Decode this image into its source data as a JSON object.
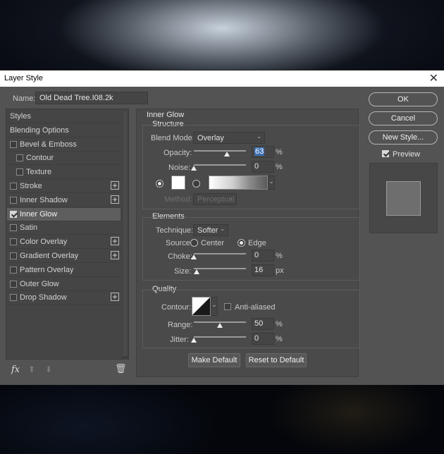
{
  "window": {
    "title": "Layer Style",
    "close_glyph": "✕"
  },
  "name_field": {
    "label": "Name:",
    "value": "Old Dead Tree.I08.2k"
  },
  "sidebar": {
    "items": [
      {
        "label": "Styles",
        "has_checkbox": false,
        "checked": false,
        "has_plus": false
      },
      {
        "label": "Blending Options",
        "has_checkbox": false,
        "checked": false,
        "has_plus": false
      },
      {
        "label": "Bevel & Emboss",
        "has_checkbox": true,
        "checked": false,
        "has_plus": false
      },
      {
        "label": "Contour",
        "has_checkbox": true,
        "checked": false,
        "has_plus": false,
        "indent": true
      },
      {
        "label": "Texture",
        "has_checkbox": true,
        "checked": false,
        "has_plus": false,
        "indent": true
      },
      {
        "label": "Stroke",
        "has_checkbox": true,
        "checked": false,
        "has_plus": true
      },
      {
        "label": "Inner Shadow",
        "has_checkbox": true,
        "checked": false,
        "has_plus": true
      },
      {
        "label": "Inner Glow",
        "has_checkbox": true,
        "checked": true,
        "has_plus": false,
        "selected": true
      },
      {
        "label": "Satin",
        "has_checkbox": true,
        "checked": false,
        "has_plus": false
      },
      {
        "label": "Color Overlay",
        "has_checkbox": true,
        "checked": false,
        "has_plus": true
      },
      {
        "label": "Gradient Overlay",
        "has_checkbox": true,
        "checked": false,
        "has_plus": true
      },
      {
        "label": "Pattern Overlay",
        "has_checkbox": true,
        "checked": false,
        "has_plus": false
      },
      {
        "label": "Outer Glow",
        "has_checkbox": true,
        "checked": false,
        "has_plus": false
      },
      {
        "label": "Drop Shadow",
        "has_checkbox": true,
        "checked": false,
        "has_plus": true
      }
    ],
    "footer": {
      "fx": "fx",
      "up_glyph": "⬆",
      "down_glyph": "⬇",
      "trash_glyph": "🗑"
    }
  },
  "inner_glow": {
    "title": "Inner Glow",
    "structure": {
      "title": "Structure",
      "blend_mode": {
        "label": "Blend Mode:",
        "value": "Overlay"
      },
      "opacity": {
        "label": "Opacity:",
        "value": "63",
        "unit": "%",
        "level": 63
      },
      "noise": {
        "label": "Noise:",
        "value": "0",
        "unit": "%",
        "level": 0
      },
      "method": {
        "label": "Method:",
        "value": "Perceptual"
      },
      "glow_color": "#ffffff"
    },
    "elements": {
      "title": "Elements",
      "technique": {
        "label": "Technique:",
        "value": "Softer"
      },
      "source": {
        "label": "Source:",
        "center": "Center",
        "edge": "Edge",
        "selected": "Edge"
      },
      "choke": {
        "label": "Choke:",
        "value": "0",
        "unit": "%",
        "level": 0
      },
      "size": {
        "label": "Size:",
        "value": "16",
        "unit": "px",
        "level": 6
      }
    },
    "quality": {
      "title": "Quality",
      "contour": {
        "label": "Contour:"
      },
      "anti_aliased": {
        "label": "Anti-aliased",
        "checked": false
      },
      "range": {
        "label": "Range:",
        "value": "50",
        "unit": "%",
        "level": 50
      },
      "jitter": {
        "label": "Jitter:",
        "value": "0",
        "unit": "%",
        "level": 0
      }
    },
    "make_default": "Make Default",
    "reset_default": "Reset to Default"
  },
  "actions": {
    "ok": "OK",
    "cancel": "Cancel",
    "new_style": "New Style...",
    "preview": {
      "label": "Preview",
      "checked": true
    }
  },
  "chevron_glyph": "⌄",
  "dropdown_arrow_glyph": "▼"
}
